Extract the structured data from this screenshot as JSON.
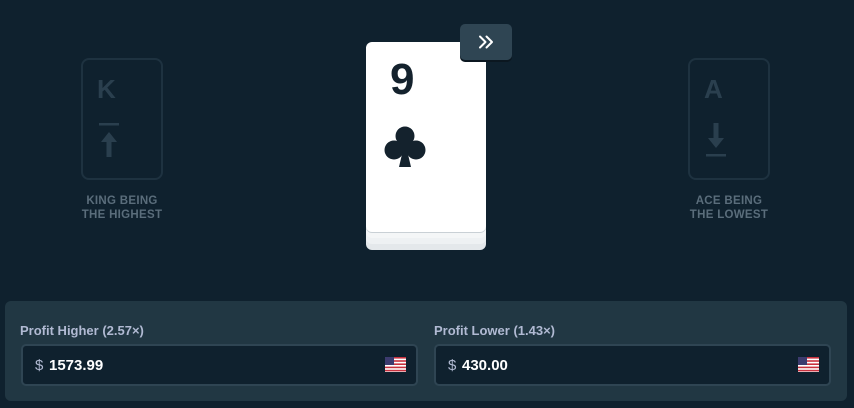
{
  "left_card": {
    "rank": "K",
    "caption_line1": "KING BEING",
    "caption_line2": "THE HIGHEST"
  },
  "right_card": {
    "rank": "A",
    "caption_line1": "ACE BEING",
    "caption_line2": "THE LOWEST"
  },
  "current_card": {
    "rank": "9",
    "suit": "clubs-icon"
  },
  "skip_button": {
    "icon": "double-chevron-right-icon"
  },
  "profit_higher": {
    "label": "Profit Higher (2.57×)",
    "currency_symbol": "$",
    "value": "1573.99",
    "flag": "us-flag-icon"
  },
  "profit_lower": {
    "label": "Profit Lower (1.43×)",
    "currency_symbol": "$",
    "value": "430.00",
    "flag": "us-flag-icon"
  },
  "colors": {
    "background": "#0f212e",
    "panel": "#213743",
    "border": "#2f4553",
    "card": "#ffffff",
    "card_ink": "#14222d"
  }
}
